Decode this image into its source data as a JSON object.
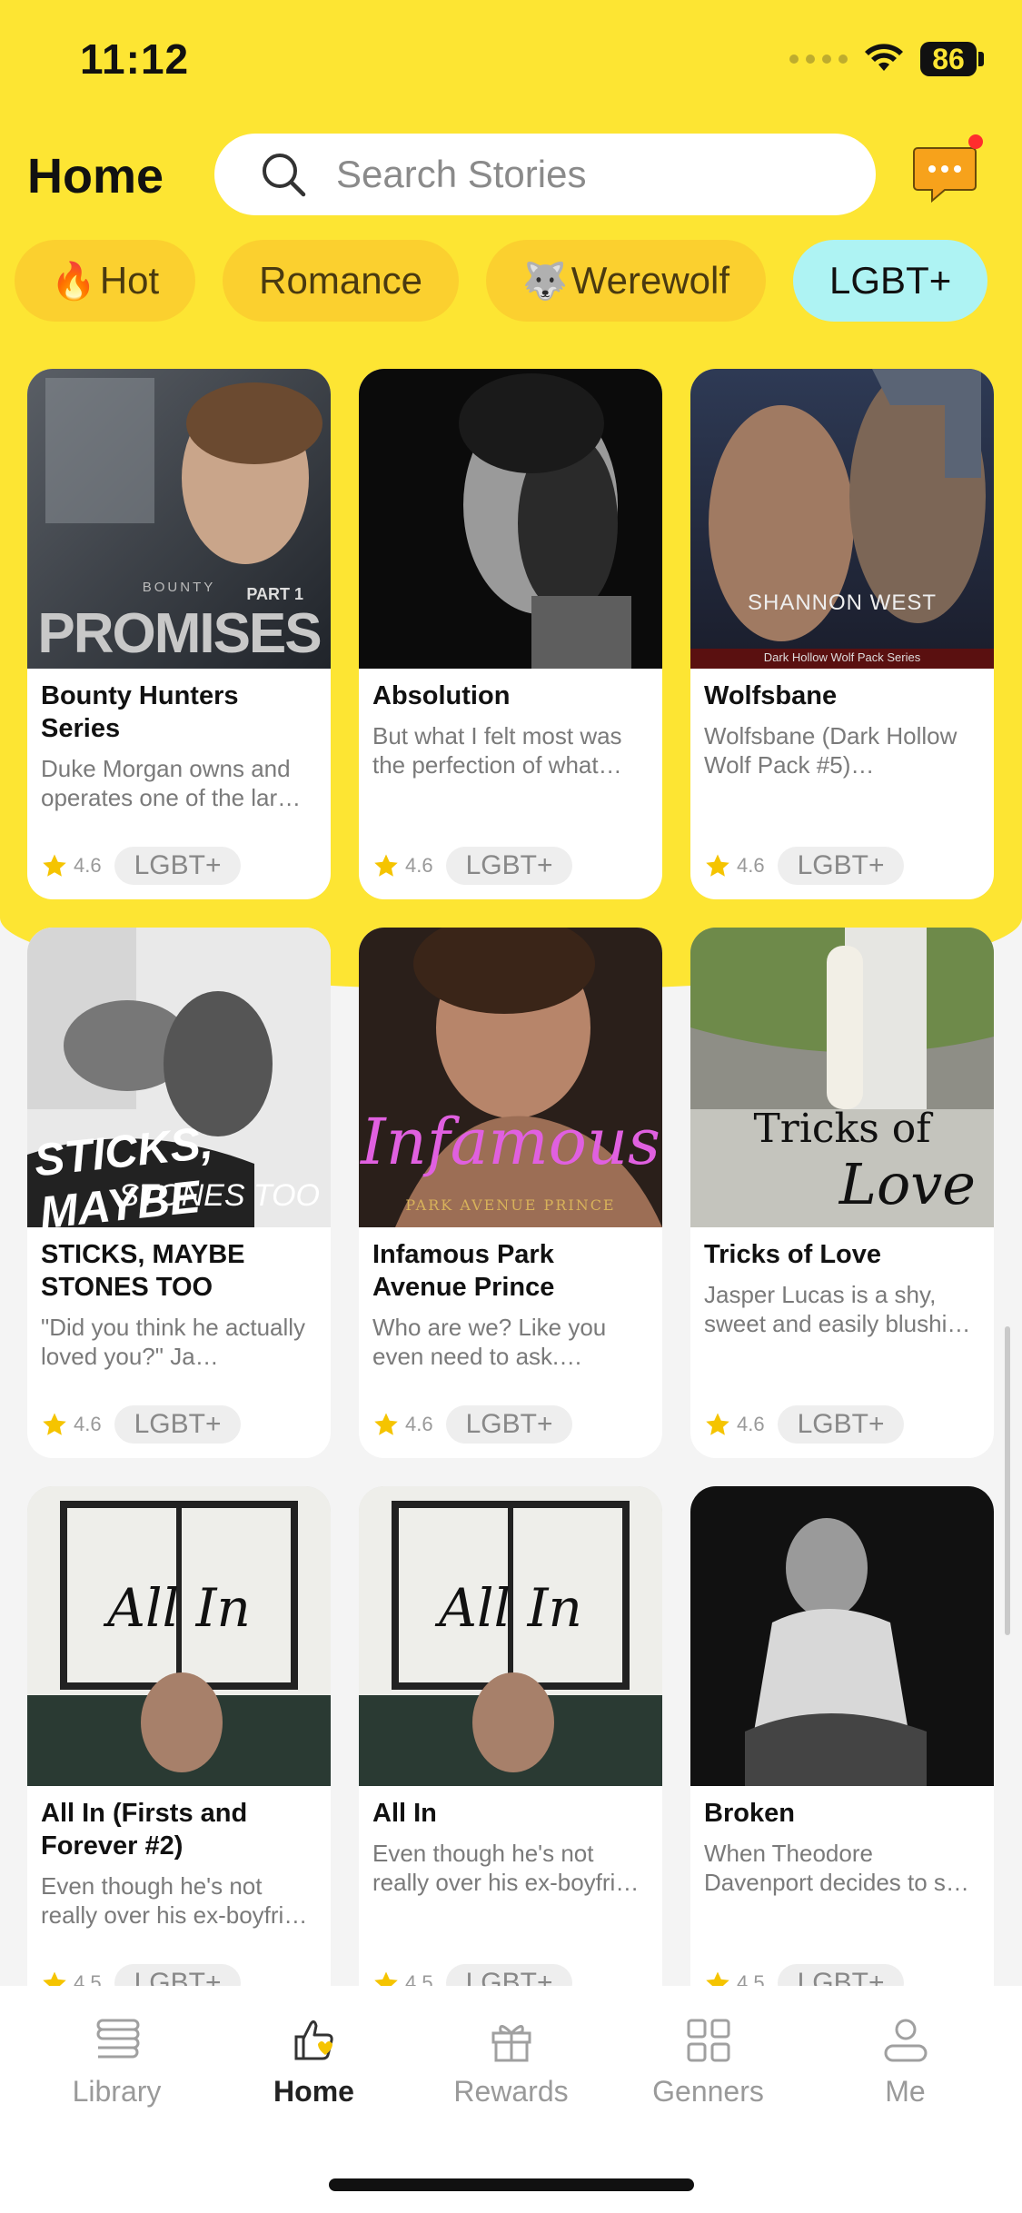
{
  "status": {
    "time": "11:12",
    "battery": "86"
  },
  "header": {
    "title": "Home",
    "search_placeholder": "Search Stories"
  },
  "tabs": [
    {
      "label": "Hot",
      "emoji": "🔥"
    },
    {
      "label": "Romance",
      "emoji": ""
    },
    {
      "label": "Werewolf",
      "emoji": "🐺"
    },
    {
      "label": "LGBT+",
      "emoji": ""
    }
  ],
  "books": [
    {
      "title": "Bounty Hunters Series",
      "desc": "Duke Morgan owns and operates one of the lar…",
      "rating": "4.6",
      "tag": "LGBT+",
      "cover_text": "PROMISES",
      "cover_sub": "PART 1",
      "cover_top": "BOUNTY"
    },
    {
      "title": "Absolution",
      "desc": "But what I felt most was the perfection of what…",
      "rating": "4.6",
      "tag": "LGBT+"
    },
    {
      "title": "Wolfsbane",
      "desc": "Wolfsbane (Dark Hollow Wolf Pack #5)…",
      "rating": "4.6",
      "tag": "LGBT+",
      "cover_text": "SHANNON WEST",
      "cover_sub": "Dark Hollow Wolf Pack Series"
    },
    {
      "title": "STICKS, MAYBE STONES TOO",
      "desc": "\"Did you think he actually loved you?\" Ja…",
      "rating": "4.6",
      "tag": "LGBT+",
      "cover_text": "STICKS, MAYBE",
      "cover_sub": "STONES TOO"
    },
    {
      "title": "Infamous Park Avenue Prince",
      "desc": "Who are we? Like you even need to ask. We¡¯r…",
      "rating": "4.6",
      "tag": "LGBT+",
      "cover_text": "Infamous",
      "cover_sub": "PARK AVENUE PRINCE"
    },
    {
      "title": "Tricks of Love",
      "desc": "Jasper Lucas is a shy, sweet and easily blushi…",
      "rating": "4.6",
      "tag": "LGBT+",
      "cover_text": "Tricks of",
      "cover_sub": "Love"
    },
    {
      "title": "All In (Firsts and Forever #2)",
      "desc": "Even though he's not really over his ex-boyfri…",
      "rating": "4.5",
      "tag": "LGBT+",
      "cover_text": "All In"
    },
    {
      "title": "All In",
      "desc": "Even though he's not really over his ex-boyfri…",
      "rating": "4.5",
      "tag": "LGBT+",
      "cover_text": "All In"
    },
    {
      "title": "Broken",
      "desc": "When Theodore Davenport decides to s…",
      "rating": "4.5",
      "tag": "LGBT+"
    }
  ],
  "nav": [
    {
      "label": "Library",
      "icon": "library-icon"
    },
    {
      "label": "Home",
      "icon": "home-icon",
      "active": true
    },
    {
      "label": "Rewards",
      "icon": "gift-icon"
    },
    {
      "label": "Genners",
      "icon": "grid-icon"
    },
    {
      "label": "Me",
      "icon": "profile-icon"
    }
  ],
  "colors": {
    "brand_yellow": "#fde533",
    "tab_yellow": "#fbd02f",
    "active_tab": "#aef3f3",
    "chat_orange": "#f7a21b",
    "star": "#f5c400"
  }
}
